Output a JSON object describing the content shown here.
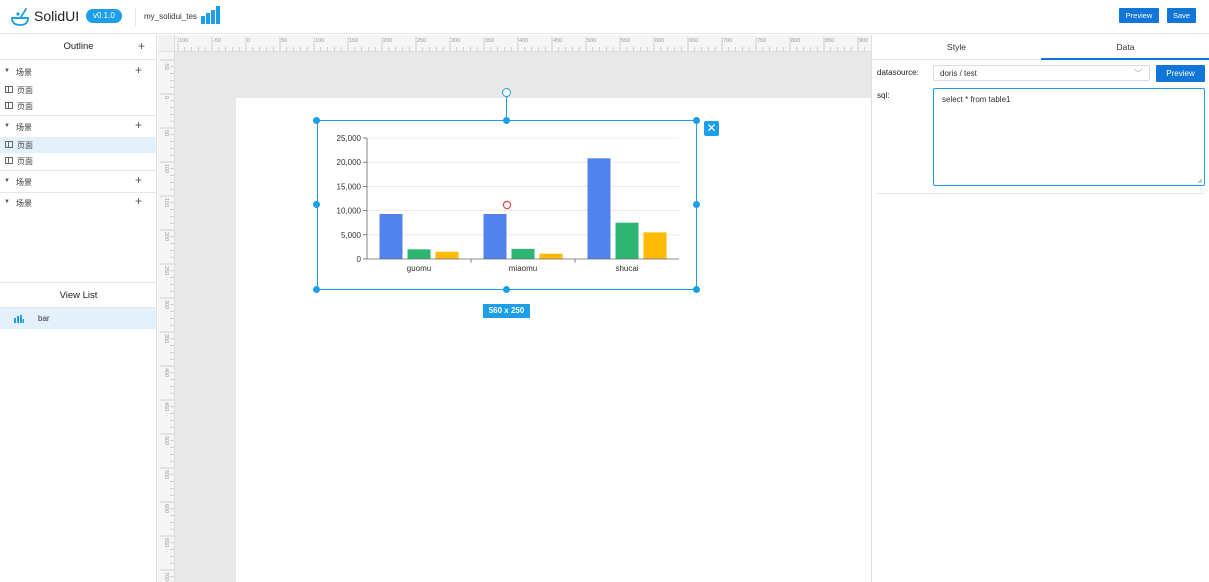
{
  "header": {
    "app_name": "SolidUI",
    "version": "v0.1.0",
    "project_name": "my_solidui_tes",
    "preview_label": "Preview",
    "save_label": "Save"
  },
  "outline": {
    "title": "Outline",
    "scenes": [
      {
        "label": "场景",
        "pages": [
          "页面",
          "页面"
        ],
        "active_page": -1
      },
      {
        "label": "场景",
        "pages": [
          "页面",
          "页面"
        ],
        "active_page": 0
      },
      {
        "label": "场景",
        "pages": []
      },
      {
        "label": "场景",
        "pages": []
      }
    ]
  },
  "view_list": {
    "title": "View List",
    "items": [
      {
        "icon": "bar-chart-icon",
        "label": "bar"
      }
    ]
  },
  "ruler": {
    "top_ticks": [
      "100",
      "-50",
      "0",
      "50",
      "100",
      "150",
      "200",
      "250",
      "300",
      "350",
      "400",
      "450",
      "500",
      "550",
      "600",
      "650",
      "700",
      "750",
      "800",
      "850",
      "900"
    ],
    "left_ticks": [
      "-50",
      "0",
      "50",
      "100",
      "150",
      "200",
      "250",
      "300",
      "350",
      "400",
      "450",
      "500",
      "550",
      "600",
      "650",
      "700"
    ]
  },
  "selection": {
    "size_label": "560 x 250"
  },
  "colors": {
    "accent": "#1c9ee8",
    "button": "#1176d8",
    "series": [
      "#5282ed",
      "#2fb572",
      "#ffbb02"
    ]
  },
  "chart_data": {
    "type": "bar",
    "categories": [
      "guomu",
      "miaomu",
      "shucai"
    ],
    "series": [
      {
        "values": [
          9300,
          9300,
          20800
        ]
      },
      {
        "values": [
          2000,
          2100,
          7500
        ]
      },
      {
        "values": [
          1500,
          1100,
          5500
        ]
      }
    ],
    "ylim": [
      0,
      25000
    ],
    "yticks": [
      "0",
      "5,000",
      "10,000",
      "15,000",
      "20,000",
      "25,000"
    ],
    "grid": true
  },
  "right_panel": {
    "tabs": [
      "Style",
      "Data"
    ],
    "active_tab": 1,
    "datasource_label": "datasource:",
    "datasource_value": "doris / test",
    "preview_label": "Preview",
    "sql_label": "sql:",
    "sql_value": "select * from table1"
  }
}
